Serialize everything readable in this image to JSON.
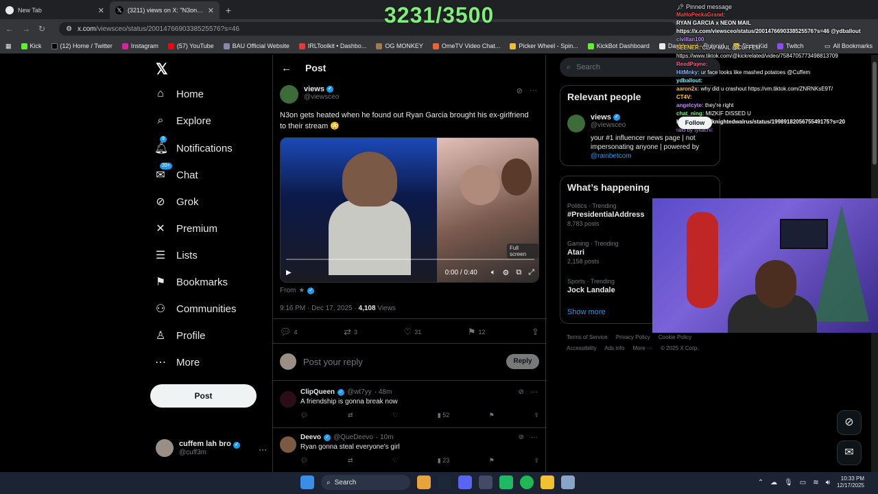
{
  "overlay": {
    "counter": "3231/3500"
  },
  "browser": {
    "tabs": [
      {
        "title": "New Tab",
        "active": false
      },
      {
        "title": "(3211) views on X: \"N3on gets I",
        "active": true
      }
    ],
    "url_host": "x.com",
    "url_path": "/viewsceo/status/2001476690338525576?s=46",
    "bookmarks": [
      "Kick",
      "(12) Home / Twitter",
      "Instagram",
      "(57) YouTube",
      "BAU Official Website",
      "IRLToolkit • Dashbo...",
      "OG MONKEY",
      "OmeTV Video Chat...",
      "Picker Wheel - Spin...",
      "KickBot Dashboard",
      "Dashboard - Pulsoid",
      "DistroKid",
      "Twitch"
    ],
    "all_bookmarks": "All Bookmarks"
  },
  "nav": {
    "items": [
      {
        "label": "Home",
        "icon": "home-icon"
      },
      {
        "label": "Explore",
        "icon": "search-icon"
      },
      {
        "label": "Notifications",
        "icon": "bell-icon",
        "badge": "9"
      },
      {
        "label": "Chat",
        "icon": "chat-icon",
        "badge": "20+"
      },
      {
        "label": "Grok",
        "icon": "grok-icon"
      },
      {
        "label": "Premium",
        "icon": "x-icon"
      },
      {
        "label": "Lists",
        "icon": "list-icon"
      },
      {
        "label": "Bookmarks",
        "icon": "bookmark-icon"
      },
      {
        "label": "Communities",
        "icon": "people-icon"
      },
      {
        "label": "Profile",
        "icon": "person-icon"
      },
      {
        "label": "More",
        "icon": "more-icon"
      }
    ],
    "post_button": "Post",
    "account": {
      "name": "cuffem lah bro",
      "handle": "@cuff3m"
    }
  },
  "post": {
    "header": "Post",
    "author": {
      "name": "views",
      "handle": "@viewsceo"
    },
    "text": "N3on gets heated when he found out Ryan Garcia brought his ex-girlfriend to their stream 😳",
    "video": {
      "time": "0:00 / 0:40",
      "fullscreen_tip": "Full screen"
    },
    "from": "From",
    "timestamp": "9:16 PM · Dec 17, 2025 · ",
    "views_count": "4,108",
    "views_label": " Views",
    "stats": {
      "replies": "4",
      "reposts": "3",
      "likes": "31",
      "bookmarks": "12"
    },
    "reply_placeholder": "Post your reply",
    "reply_button": "Reply"
  },
  "replies": [
    {
      "name": "ClipQueen",
      "handle": "@wt7yy",
      "time": "· 48m",
      "text": "A friendship is gonna break now",
      "views": "52",
      "avatar_color": "#2a0d16"
    },
    {
      "name": "Deevo",
      "handle": "@QueDeevo",
      "time": "· 10m",
      "text": "Ryan gonna steal everyone's girl",
      "views": "23",
      "avatar_color": "#7a5a40"
    }
  ],
  "right": {
    "search_placeholder": "Search",
    "relevant_title": "Relevant people",
    "relevant_person": {
      "name": "views",
      "handle": "@viewsceo",
      "bio": "your #1 influencer news page | not impersonating anyone | powered by",
      "link": "@rainbetcom",
      "follow": "Follow"
    },
    "happening_title": "What’s happening",
    "trends": [
      {
        "category": "Politics · Trending",
        "topic": "#PresidentialAddress",
        "posts": "8,783 posts"
      },
      {
        "category": "Gaming · Trending",
        "topic": "Atari",
        "posts": "2,158 posts"
      },
      {
        "category": "Sports · Trending",
        "topic": "Jock Landale",
        "posts": ""
      }
    ],
    "show_more": "Show more",
    "footer": [
      "Terms of Service",
      "Privacy Policy",
      "Cookie Policy",
      "Accessibility",
      "Ads info",
      "More ···",
      "© 2025 X Corp."
    ]
  },
  "chat": {
    "pinned_label": "Pinned message",
    "messages": [
      {
        "user": "MaHoPeckaGrand",
        "text": ":"
      },
      {
        "user": "",
        "text": "RYAN GARCIA x NEON MAIL"
      },
      {
        "user": "",
        "text": "https://x.com/viewsceo/status/2001476690338525576?s=46 @ydballout"
      },
      {
        "user": "civillan100",
        "text": ""
      },
      {
        "user": "SEENER:",
        "text": "CLAV MAIL @CUFFEM"
      },
      {
        "user": "",
        "text": "https://www.tiktok.com/@kickrelated/video/7584705773498813709"
      },
      {
        "user": "ReedPayne:",
        "text": ""
      },
      {
        "user": "HitMnky:",
        "text": "ur face looks like mashed potatoes @Cuffem"
      },
      {
        "user": "ydballout:",
        "text": ""
      },
      {
        "user": "aaron2x:",
        "text": "why did u crashout https://vm.tiktok.com/ZNRNKsE9T/"
      },
      {
        "user": "CT4V:",
        "text": ""
      },
      {
        "user": "angelcyte:",
        "text": "they're right"
      },
      {
        "user": "chat_ning:",
        "text": "MIZKIF DISSED U"
      },
      {
        "user": "",
        "text": "https://x.com/knightedwalrus/status/1998918205675549175?s=20"
      },
      {
        "user": "",
        "text": "raid by tyitachi:"
      }
    ]
  },
  "taskbar": {
    "search": "Search",
    "time": "10:33 PM",
    "date": "12/17/2025"
  }
}
